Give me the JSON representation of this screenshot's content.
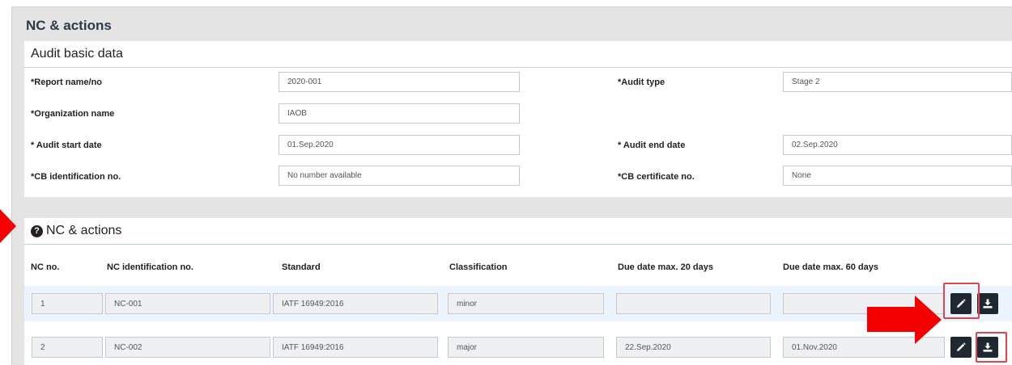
{
  "page": {
    "title": "NC & actions"
  },
  "audit_basic": {
    "title": "Audit basic data",
    "fields": [
      {
        "label": "*Report name/no",
        "value": "2020-001"
      },
      {
        "label": "*Audit type",
        "value": "Stage 2"
      },
      {
        "label": "*Organization name",
        "value": "IAOB"
      },
      {
        "label": "* Audit start date",
        "value": "01.Sep.2020"
      },
      {
        "label": "* Audit end date",
        "value": "02.Sep.2020"
      },
      {
        "label": "*CB identification no.",
        "value": "No number available"
      },
      {
        "label": "*CB certificate no.",
        "value": "None"
      }
    ]
  },
  "nc_actions": {
    "title": "NC & actions",
    "columns": [
      "NC no.",
      "NC identification no.",
      "Standard",
      "Classification",
      "Due date max. 20 days",
      "Due date max. 60 days"
    ],
    "rows": [
      [
        "1",
        "NC-001",
        "IATF 16949:2016",
        "minor",
        "",
        ""
      ],
      [
        "2",
        "NC-002",
        "IATF 16949:2016",
        "major",
        "22.Sep.2020",
        "01.Nov.2020"
      ]
    ]
  },
  "icons": {
    "edit": "pencil-icon",
    "download": "download-icon",
    "help": "question-circle-icon"
  },
  "colors": {
    "annotation_red": "#f50000",
    "highlight_box": "#e0474c",
    "button_dark": "#1f2730",
    "selected_row": "#ebf3fc"
  }
}
